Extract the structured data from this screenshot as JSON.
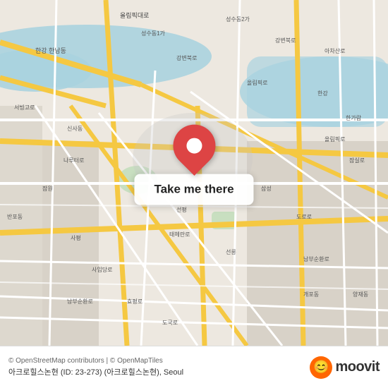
{
  "map": {
    "attribution": "© OpenStreetMap contributors | © OpenMapTiles",
    "location": "아크로힐스논현 (ID: 23-273) (아크로힐스논현), Seoul"
  },
  "button": {
    "label": "Take me there"
  },
  "footer": {
    "attribution": "© OpenStreetMap contributors | © OpenMapTiles",
    "location_name": "아크로힐스논현 (ID: 23-273) (아크로힐스논현), Seoul"
  },
  "moovit": {
    "logo_text": "moovit",
    "emoji": "😊"
  }
}
